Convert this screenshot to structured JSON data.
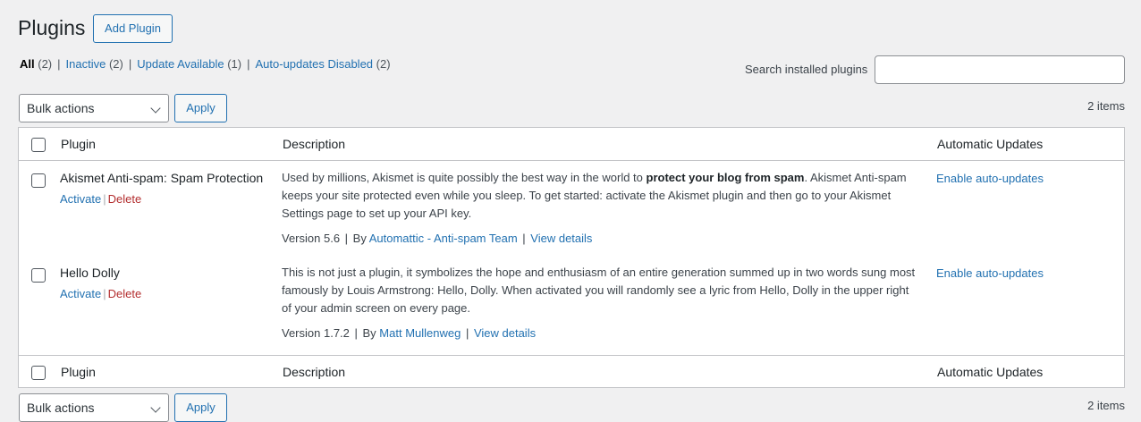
{
  "header": {
    "title": "Plugins",
    "add_button": "Add Plugin"
  },
  "filters": [
    {
      "label": "All",
      "count": "(2)"
    },
    {
      "label": "Inactive",
      "count": "(2)"
    },
    {
      "label": "Update Available",
      "count": "(1)"
    },
    {
      "label": "Auto-updates Disabled",
      "count": "(2)"
    }
  ],
  "search": {
    "label": "Search installed plugins",
    "value": ""
  },
  "bulk": {
    "selected": "Bulk actions",
    "apply": "Apply",
    "items_count": "2 items"
  },
  "columns": {
    "plugin": "Plugin",
    "description": "Description",
    "auto_updates": "Automatic Updates"
  },
  "plugins": [
    {
      "name": "Akismet Anti-spam: Spam Protection",
      "activate": "Activate",
      "delete": "Delete",
      "desc_before": "Used by millions, Akismet is quite possibly the best way in the world to ",
      "desc_bold": "protect your blog from spam",
      "desc_after": ". Akismet Anti-spam keeps your site protected even while you sleep. To get started: activate the Akismet plugin and then go to your Akismet Settings page to set up your API key.",
      "version": "Version 5.6",
      "by": "By",
      "author": "Automattic - Anti-spam Team",
      "view_details": "View details",
      "auto_update": "Enable auto-updates"
    },
    {
      "name": "Hello Dolly",
      "activate": "Activate",
      "delete": "Delete",
      "desc": "This is not just a plugin, it symbolizes the hope and enthusiasm of an entire generation summed up in two words sung most famously by Louis Armstrong: Hello, Dolly. When activated you will randomly see a lyric from Hello, Dolly in the upper right of your admin screen on every page.",
      "version": "Version 1.7.2",
      "by": "By",
      "author": "Matt Mullenweg",
      "view_details": "View details",
      "auto_update": "Enable auto-updates"
    }
  ],
  "colors": {
    "link": "#2271b1",
    "delete": "#b32d2e",
    "background": "#f0f0f1"
  }
}
